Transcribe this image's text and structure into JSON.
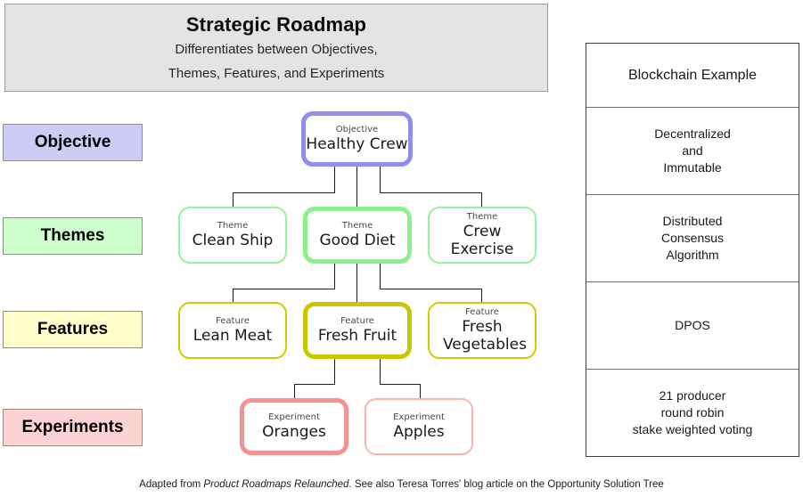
{
  "header": {
    "title": "Strategic Roadmap",
    "subtitle_line1": "Differentiates between Objectives,",
    "subtitle_line2": "Themes, Features, and Experiments",
    "background": "#e4e4e4"
  },
  "categories": [
    {
      "label": "Objective",
      "color": "#ccccf5",
      "name": "objective"
    },
    {
      "label": "Themes",
      "color": "#ccffcc",
      "name": "themes"
    },
    {
      "label": "Features",
      "color": "#ffffcc",
      "name": "features"
    },
    {
      "label": "Experiments",
      "color": "#fcd2d2",
      "name": "experiments"
    }
  ],
  "tree": {
    "objective": {
      "kind": "Objective",
      "title": "Healthy Crew",
      "border_color": "#8e8ef0",
      "highlighted": true
    },
    "themes": [
      {
        "kind": "Theme",
        "title": "Clean Ship",
        "border_color": "#97f397",
        "highlighted": false
      },
      {
        "kind": "Theme",
        "title": "Good Diet",
        "border_color": "#8cf08c",
        "highlighted": true
      },
      {
        "kind": "Theme",
        "title": "Crew Exercise",
        "border_color": "#97f397",
        "highlighted": false
      }
    ],
    "features": [
      {
        "kind": "Feature",
        "title": "Lean Meat",
        "border_color": "#cccc00",
        "highlighted": false
      },
      {
        "kind": "Feature",
        "title": "Fresh Fruit",
        "border_color": "#c8c800",
        "highlighted": true
      },
      {
        "kind": "Feature",
        "title": "Fresh Vegetables",
        "border_color": "#cccc00",
        "highlighted": false
      }
    ],
    "experiments": [
      {
        "kind": "Experiment",
        "title": "Oranges",
        "border_color": "#f59191",
        "highlighted": true
      },
      {
        "kind": "Experiment",
        "title": "Apples",
        "border_color": "#fbb4b4",
        "highlighted": false
      }
    ]
  },
  "blockchain_table": {
    "header": "Blockchain Example",
    "rows": [
      {
        "lines": [
          "Decentralized",
          "and",
          "Immutable"
        ]
      },
      {
        "lines": [
          "Distributed",
          "Consensus",
          "Algorithm"
        ]
      },
      {
        "lines": [
          "DPOS"
        ]
      },
      {
        "lines": [
          "21 producer",
          "round robin",
          "stake weighted voting"
        ]
      }
    ]
  },
  "footer": {
    "prefix": "Adapted from ",
    "book_title": "Product Roadmaps Relaunched",
    "suffix": ". See also Teresa Torres' blog article on the Opportunity Solution Tree"
  }
}
